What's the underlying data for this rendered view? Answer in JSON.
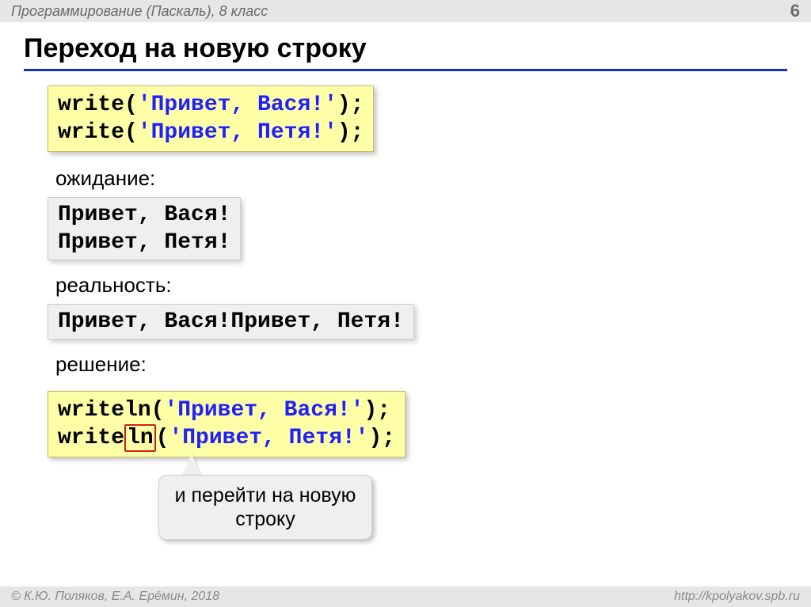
{
  "header": {
    "course": "Программирование (Паскаль), 8 класс",
    "page": "6"
  },
  "title": "Переход на новую строку",
  "code1": {
    "line1": {
      "fn": "write",
      "open": "(",
      "str": "'Привет, Вася!'",
      "close": ");"
    },
    "line2": {
      "fn": "write",
      "open": "(",
      "str": "'Привет, Петя!'",
      "close": ");"
    }
  },
  "labels": {
    "expectation": "ожидание:",
    "reality": "реальность:",
    "solution": "решение:"
  },
  "expected": {
    "line1": "Привет, Вася!",
    "line2": "Привет, Петя!"
  },
  "reality": "Привет, Вася!Привет, Петя!",
  "code2": {
    "line1": {
      "fn": "writeln",
      "open": "(",
      "str": "'Привет, Вася!'",
      "close": ");"
    },
    "line2": {
      "fnpre": "write",
      "fnhi": "ln",
      "open": "(",
      "str": "'Привет, Петя!'",
      "close": ");"
    }
  },
  "callout": "и перейти на новую строку",
  "footer": {
    "left": "© К.Ю. Поляков, Е.А. Ерёмин, 2018",
    "right": "http://kpolyakov.spb.ru"
  }
}
